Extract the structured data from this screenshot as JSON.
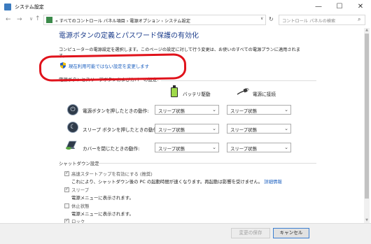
{
  "window": {
    "title": "システム設定",
    "controls": {
      "minimize": "—",
      "maximize": "☐",
      "close": "✕"
    }
  },
  "nav": {
    "back": "←",
    "forward": "→",
    "up": "↑",
    "breadcrumb": "« すべてのコントロール パネル項目 › 電源オプション › システム設定",
    "dropdown": "∨",
    "refresh": "↻",
    "search_placeholder": "コントロール パネルの検索",
    "search_icon": "search-icon"
  },
  "main": {
    "heading": "電源ボタンの定義とパスワード保護の有効化",
    "intro": "コンピューターの電源設定を選択します。このページの設定に対して行う変更は、お使いのすべての電源プランに適用されます。",
    "change_link": "現在利用可能ではない設定を変更します",
    "section_title_partial": "電源ボタンとスリープボタンおよびカバーの設定:",
    "columns": {
      "battery": "バッテリ駆動",
      "plugged": "電源に接続"
    },
    "rows": [
      {
        "label": "電源ボタンを押したときの動作:",
        "battery": "スリープ状態",
        "plugged": "スリープ状態",
        "icon": "power-icon"
      },
      {
        "label": "スリープ ボタンを押したときの動作:",
        "battery": "スリープ状態",
        "plugged": "スリープ状態",
        "icon": "sleep-moon-icon"
      },
      {
        "label": "カバーを閉じたときの動作:",
        "battery": "スリープ状態",
        "plugged": "スリープ状態",
        "icon": "laptop-lid-icon"
      }
    ],
    "shutdown": {
      "title": "シャットダウン設定",
      "items": [
        {
          "label": "高速スタートアップを有効にする (推奨)",
          "checked": true,
          "desc": "これにより、シャットダウン後の PC の起動時間が速くなります。再起動は影響を受けません。",
          "link": "詳細情報"
        },
        {
          "label": "スリープ",
          "checked": true,
          "desc": "電源メニューに表示されます。"
        },
        {
          "label": "休止状態",
          "checked": false,
          "desc": "電源メニューに表示されます。"
        },
        {
          "label": "ロック",
          "checked": true,
          "desc": ""
        }
      ]
    }
  },
  "footer": {
    "save": "変更の保存",
    "cancel": "キャンセル"
  },
  "annotation": {
    "color": "#e0121b"
  },
  "colors": {
    "heading": "#1d3e8c",
    "link": "#1b5fbf"
  }
}
